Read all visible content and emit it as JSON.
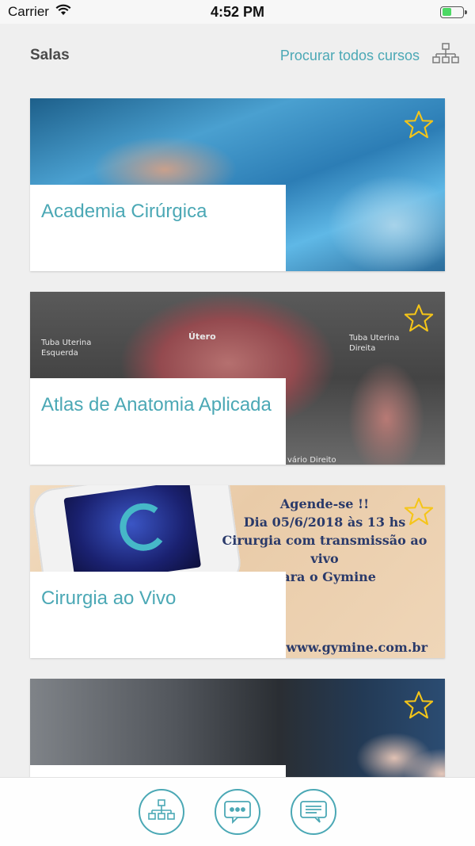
{
  "status_bar": {
    "carrier": "Carrier",
    "time": "4:52 PM",
    "battery_level": 0.45,
    "icons": [
      "wifi-icon",
      "battery-icon"
    ]
  },
  "header": {
    "title": "Salas",
    "browse_link": "Procurar todos cursos",
    "icon": "hierarchy-icon"
  },
  "colors": {
    "accent": "#4ba8b5",
    "star": "#f5c518",
    "background": "#efefef"
  },
  "cards": [
    {
      "title": "Academia Cirúrgica",
      "favorite_icon": "star-icon",
      "image_text": []
    },
    {
      "title": "Atlas de Anatomia Aplicada",
      "favorite_icon": "star-icon",
      "image_text": [
        "Útero",
        "Tuba Uterina Esquerda",
        "Tuba Uterina Direita",
        "vário Direito"
      ]
    },
    {
      "title": "Cirurgia ao Vivo",
      "favorite_icon": "star-icon",
      "image_text": [
        "Agende-se !!",
        "Dia 05/6/2018 às 13 hs",
        "Cirurgia com transmissão ao vivo",
        "para o Gymine",
        "www.gymine.com.br"
      ]
    },
    {
      "title": "",
      "favorite_icon": "star-icon",
      "image_text": []
    }
  ],
  "bottom_nav": [
    {
      "icon": "hierarchy-icon"
    },
    {
      "icon": "chat-bubble-icon"
    },
    {
      "icon": "message-icon"
    }
  ]
}
